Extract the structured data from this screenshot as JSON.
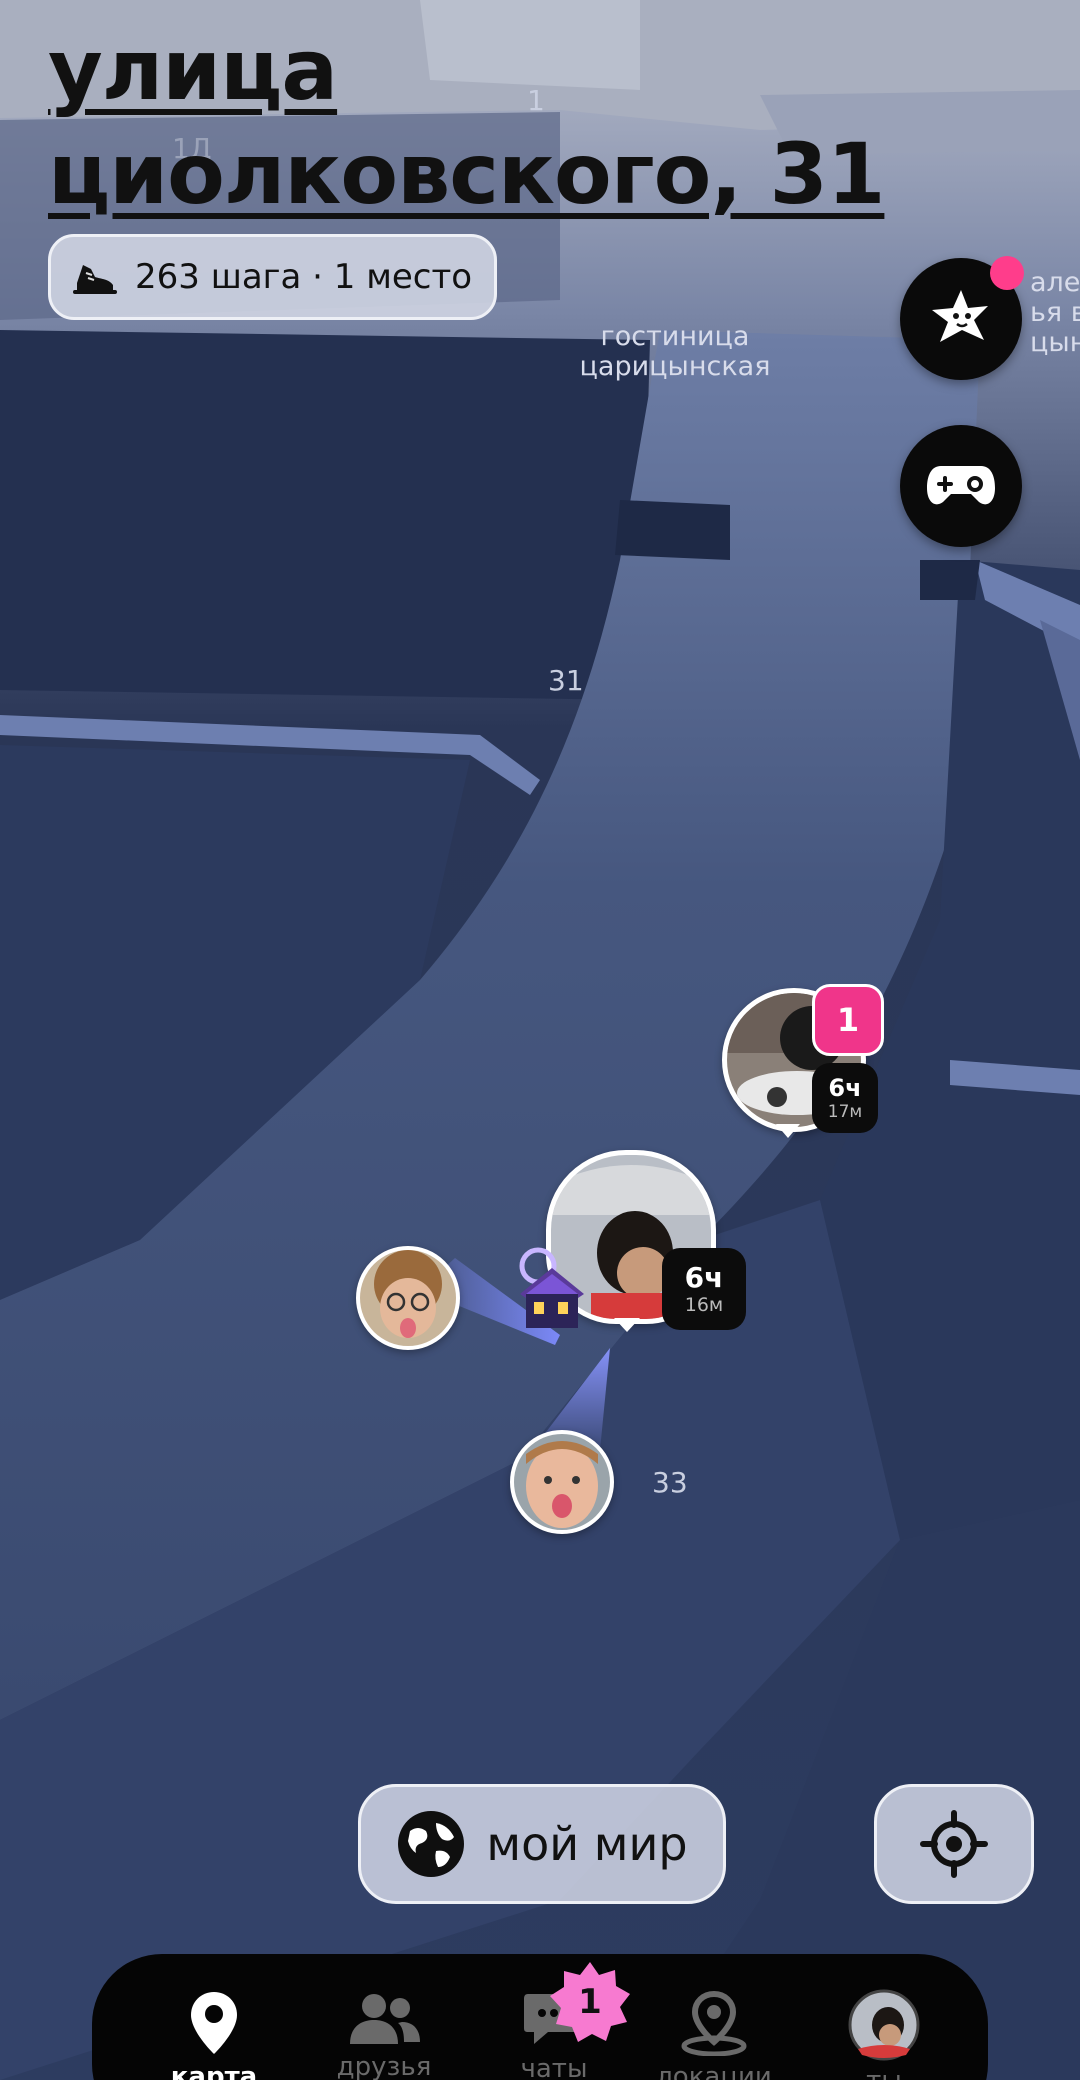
{
  "header": {
    "address": "улица циолковского, 31",
    "steps": "263 шага · 1 место"
  },
  "map": {
    "labels": {
      "hotel": "гостиница царицынская",
      "side_text": "але\nья вы\nцын",
      "num_1": "1",
      "num_1d": "1Д",
      "num_31": "31",
      "num_33": "33"
    }
  },
  "markers": {
    "friend_top": {
      "count": "1",
      "hours": "6ч",
      "minutes": "17м"
    },
    "me": {
      "hours": "6ч",
      "minutes": "16м"
    }
  },
  "buttons": {
    "my_world": "мой мир",
    "stars_icon": "star-character-icon",
    "games_icon": "gamepad-icon",
    "locate_icon": "crosshair-icon"
  },
  "tabbar": {
    "tabs": [
      {
        "label": "карта",
        "icon": "map-pin-icon",
        "active": true
      },
      {
        "label": "друзья",
        "icon": "friends-icon",
        "active": false
      },
      {
        "label": "чаты",
        "icon": "chat-icon",
        "active": false,
        "badge": "1"
      },
      {
        "label": "локации",
        "icon": "location-icon",
        "active": false
      },
      {
        "label": "ты",
        "icon": "avatar",
        "active": false
      }
    ]
  },
  "colors": {
    "map_bg": "#2f3f63",
    "accent_pink": "#f0358a",
    "badge_pink": "#f77ad0"
  }
}
